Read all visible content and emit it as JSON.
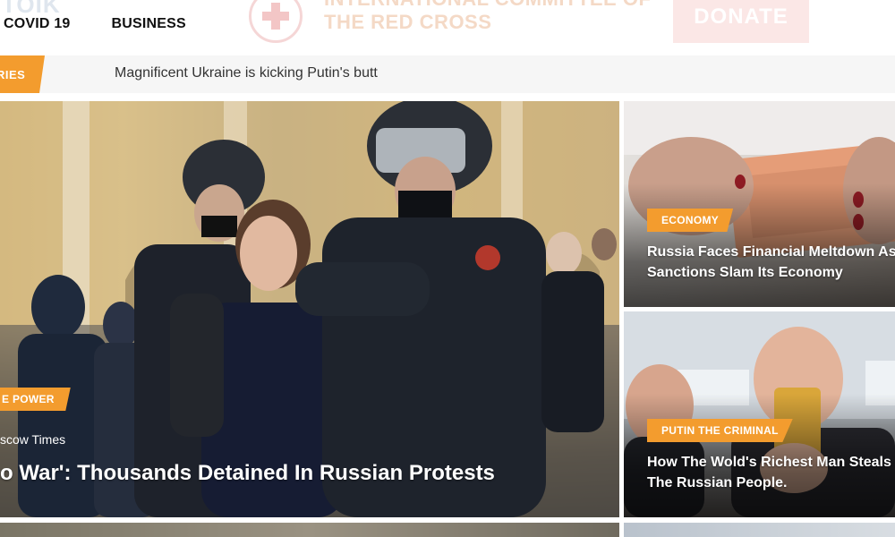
{
  "header": {
    "logo_fragment": "TOIK",
    "nav": [
      "COVID 19",
      "BUSINESS"
    ],
    "banner_text": "INTERNATIONAL COMMITTEE OF THE RED CROSS",
    "donate_label": "DONATE"
  },
  "ticker": {
    "label": "RIES",
    "text": "Magnificent Ukraine is kicking Putin's butt"
  },
  "main_story": {
    "tag": "E POWER",
    "source": "scow Times",
    "title": "o War': Thousands Detained In Russian Protests"
  },
  "side_stories": [
    {
      "tag": "ECONOMY",
      "title_line1": "Russia Faces Financial Meltdown As",
      "title_line2": "Sanctions Slam Its Economy"
    },
    {
      "tag": "PUTIN THE CRIMINAL",
      "title_line1": "How The Wold's Richest Man Steals F",
      "title_line2": "The Russian People."
    }
  ],
  "colors": {
    "accent": "#f39c2e",
    "ticker_bg": "#f6f6f6"
  }
}
